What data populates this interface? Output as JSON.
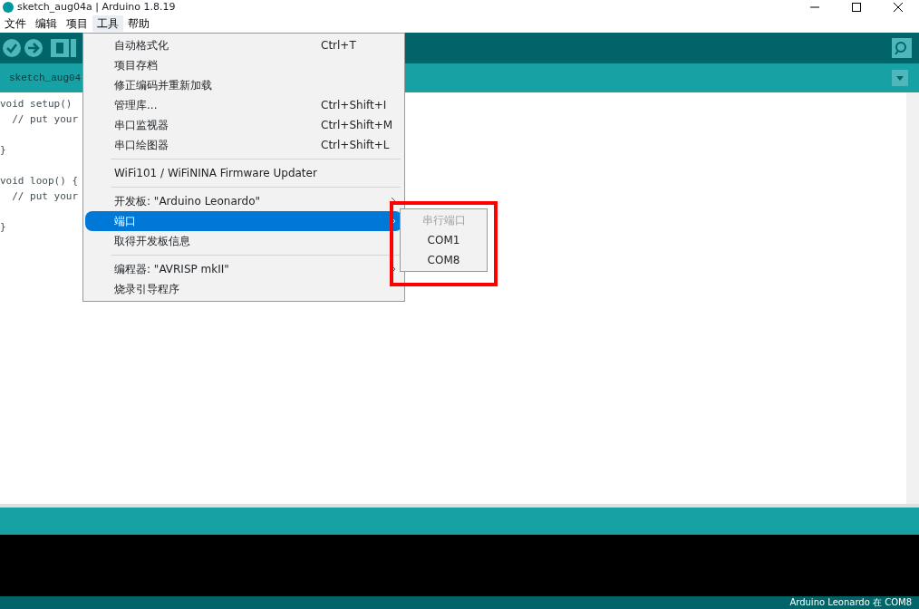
{
  "window": {
    "title": "sketch_aug04a | Arduino 1.8.19"
  },
  "menubar": [
    {
      "label": "文件",
      "selected": false
    },
    {
      "label": "编辑",
      "selected": false
    },
    {
      "label": "项目",
      "selected": false
    },
    {
      "label": "工具",
      "selected": true
    },
    {
      "label": "帮助",
      "selected": false
    }
  ],
  "tab": {
    "label": "sketch_aug04"
  },
  "code_blocks": [
    [
      "void setup()",
      "  // put your"
    ],
    [
      "}"
    ],
    [
      "void loop() {",
      "  // put your"
    ],
    [
      "}"
    ]
  ],
  "tools_menu": [
    {
      "kind": "item",
      "label": "自动格式化",
      "shortcut": "Ctrl+T",
      "submenu": false,
      "selected": false
    },
    {
      "kind": "item",
      "label": "项目存档",
      "submenu": false,
      "selected": false
    },
    {
      "kind": "item",
      "label": "修正编码并重新加载",
      "submenu": false,
      "selected": false
    },
    {
      "kind": "item",
      "label": "管理库...",
      "shortcut": "Ctrl+Shift+I",
      "submenu": false,
      "selected": false
    },
    {
      "kind": "item",
      "label": "串口监视器",
      "shortcut": "Ctrl+Shift+M",
      "submenu": false,
      "selected": false
    },
    {
      "kind": "item",
      "label": "串口绘图器",
      "shortcut": "Ctrl+Shift+L",
      "submenu": false,
      "selected": false
    },
    {
      "kind": "separator"
    },
    {
      "kind": "item",
      "label": "WiFi101 / WiFiNINA Firmware Updater",
      "submenu": false,
      "selected": false
    },
    {
      "kind": "separator"
    },
    {
      "kind": "item",
      "label": "开发板: \"Arduino Leonardo\"",
      "submenu": true,
      "selected": false
    },
    {
      "kind": "item",
      "label": "端口",
      "submenu": true,
      "selected": true
    },
    {
      "kind": "item",
      "label": "取得开发板信息",
      "submenu": false,
      "selected": false
    },
    {
      "kind": "separator"
    },
    {
      "kind": "item",
      "label": "编程器: \"AVRISP mkII\"",
      "submenu": true,
      "selected": false
    },
    {
      "kind": "item",
      "label": "烧录引导程序",
      "submenu": false,
      "selected": false
    }
  ],
  "port_submenu": {
    "highlighted": true,
    "items": [
      {
        "label": "串行端口",
        "disabled": true
      },
      {
        "label": "COM1",
        "disabled": false
      },
      {
        "label": "COM8",
        "disabled": false
      }
    ]
  },
  "status_bar": {
    "text": "Arduino Leonardo 在 COM8"
  }
}
